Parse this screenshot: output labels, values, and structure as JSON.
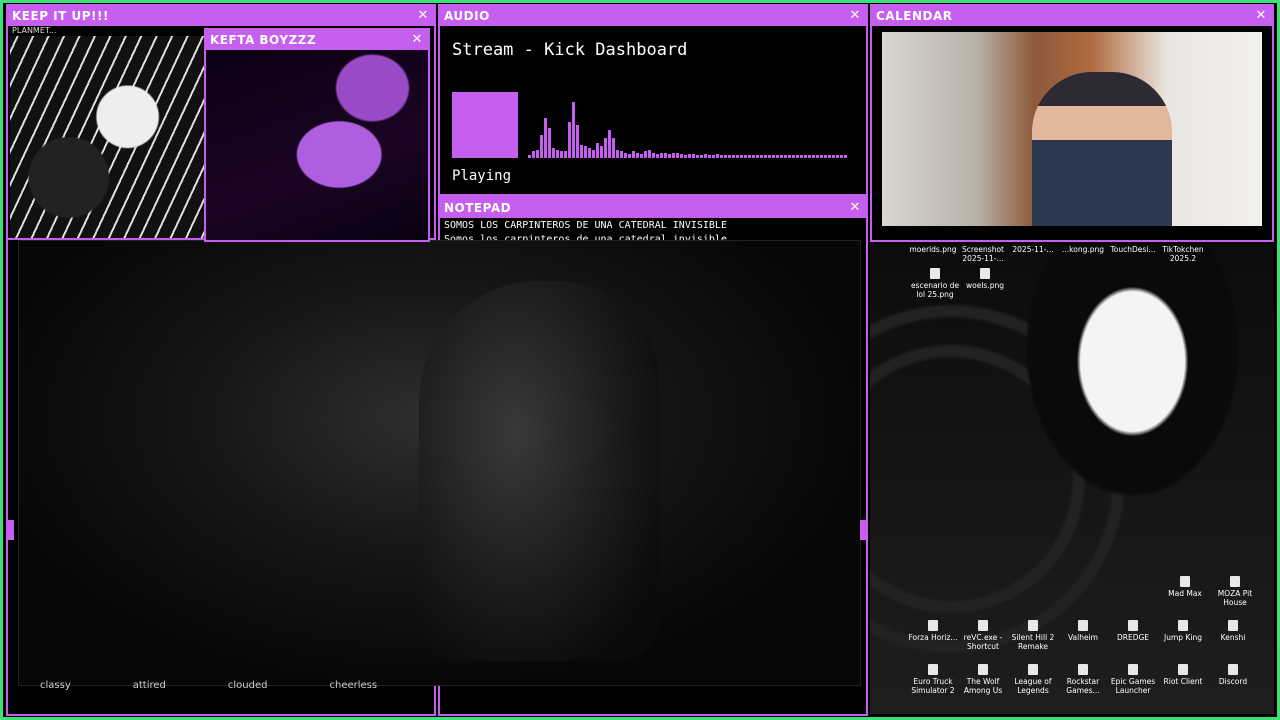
{
  "panels": {
    "keep": {
      "title": "KEEP IT UP!!!",
      "sub": "PLANMET...",
      "close": "✕"
    },
    "kefta": {
      "title": "KEFTA BOYZZZ",
      "close": "✕"
    },
    "audio": {
      "title": "AUDIO",
      "close": "✕",
      "track": "Stream - Kick Dashboard",
      "status": "Playing"
    },
    "notepad": {
      "title": "NOTEPAD",
      "close": "✕",
      "lines": [
        "SOMOS LOS CARPINTEROS DE UNA CATEDRAL INVISIBLE",
        "Somos los carpinteros de una catedral invisible"
      ]
    },
    "calendar": {
      "title": "CALENDAR",
      "close": "✕"
    }
  },
  "audio_levels": [
    0.05,
    0.1,
    0.12,
    0.35,
    0.6,
    0.45,
    0.15,
    0.12,
    0.1,
    0.1,
    0.55,
    0.85,
    0.5,
    0.2,
    0.18,
    0.15,
    0.12,
    0.22,
    0.18,
    0.3,
    0.42,
    0.3,
    0.12,
    0.1,
    0.08,
    0.06,
    0.1,
    0.08,
    0.06,
    0.1,
    0.12,
    0.08,
    0.06,
    0.08,
    0.07,
    0.06,
    0.08,
    0.07,
    0.06,
    0.05,
    0.06,
    0.06,
    0.05,
    0.05,
    0.06,
    0.05,
    0.05,
    0.06,
    0.05,
    0.05,
    0.05,
    0.05,
    0.05,
    0.05,
    0.05,
    0.05,
    0.05,
    0.05,
    0.05,
    0.05,
    0.05,
    0.05,
    0.05,
    0.05,
    0.05,
    0.05,
    0.05,
    0.05,
    0.05,
    0.05,
    0.05,
    0.05,
    0.05,
    0.05,
    0.05,
    0.05,
    0.05,
    0.05,
    0.05,
    0.05
  ],
  "video_words": [
    "classy",
    "attired",
    "clouded",
    "cheerless"
  ],
  "desktop_icons": {
    "top": [
      "moerids.png",
      "Screenshot 2025-11-...",
      "2025-11-...",
      "...kong.png",
      "TouchDesi...",
      "TikTokchen 2025.2"
    ],
    "files": [
      "escenario de lol 25.png",
      "woels.png"
    ],
    "row1": [
      "Mad Max",
      "MOZA Pit House"
    ],
    "row2": [
      "Forza Horiz...",
      "reVC.exe - Shortcut",
      "Silent Hill 2 Remake",
      "Valheim",
      "DREDGE",
      "Jump King",
      "Kenshi"
    ],
    "row3": [
      "Euro Truck Simulator 2",
      "The Wolf Among Us",
      "League of Legends",
      "Rockstar Games...",
      "Epic Games Launcher",
      "Riot Client",
      "Discord"
    ]
  },
  "colors": {
    "accent": "#c65ff0",
    "frame": "#3ee07a"
  }
}
